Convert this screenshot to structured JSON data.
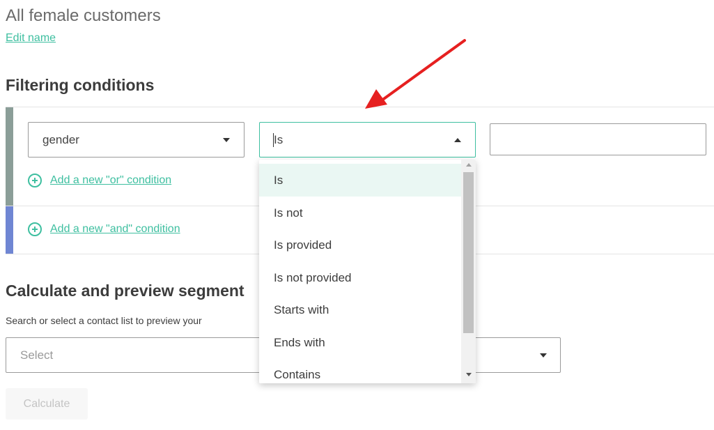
{
  "segment": {
    "name": "All female customers",
    "edit_label": "Edit name"
  },
  "filtering": {
    "title": "Filtering conditions",
    "field_value": "gender",
    "operator_value": "Is",
    "value_input": "",
    "add_or_label": "Add a new \"or\" condition",
    "add_and_label": "Add a new \"and\" condition"
  },
  "operator_dropdown": {
    "selected": "Is",
    "options": [
      "Is",
      "Is not",
      "Is provided",
      "Is not provided",
      "Starts with",
      "Ends with",
      "Contains"
    ]
  },
  "preview": {
    "title": "Calculate and preview segment",
    "description": "Search or select a contact list to preview your",
    "select_placeholder": "Select",
    "calculate_label": "Calculate"
  },
  "colors": {
    "accent": "#3ebfa0",
    "or_bar": "#8b9e98",
    "and_bar": "#6f86d3",
    "annotation_arrow": "#e62020"
  },
  "icons": [
    "plus-circle-icon",
    "chevron-down-icon",
    "chevron-up-icon",
    "annotation-arrow-icon"
  ]
}
